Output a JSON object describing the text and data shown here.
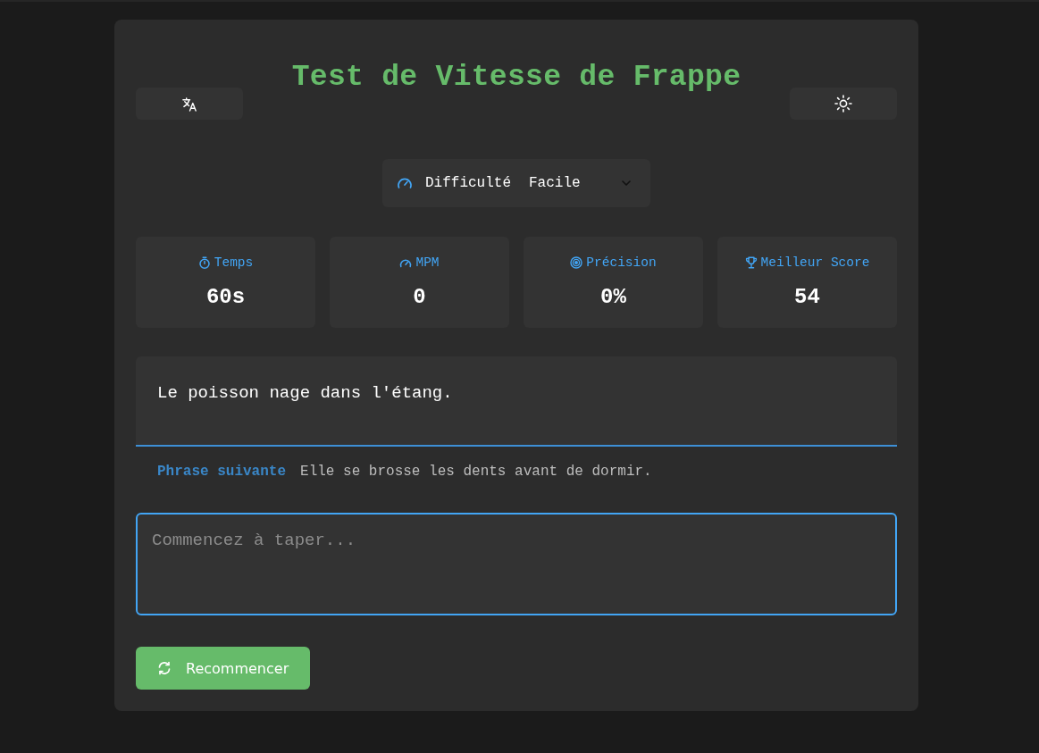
{
  "header": {
    "title": "Test de Vitesse de Frappe"
  },
  "difficulty": {
    "label": "Difficulté",
    "value": "Facile"
  },
  "stats": [
    {
      "kind": "time",
      "label": "Temps",
      "value": "60s"
    },
    {
      "kind": "speed",
      "label": "MPM",
      "value": "0"
    },
    {
      "kind": "accuracy",
      "label": "Précision",
      "value": "0%"
    },
    {
      "kind": "best",
      "label": "Meilleur Score",
      "value": "54"
    }
  ],
  "current_sentence": "Le poisson nage dans l'étang.",
  "next_sentence": {
    "label": "Phrase suivante",
    "text": "Elle se brosse les dents avant de dormir."
  },
  "input": {
    "placeholder": "Commencez à taper..."
  },
  "restart_button": {
    "label": "Recommencer"
  }
}
